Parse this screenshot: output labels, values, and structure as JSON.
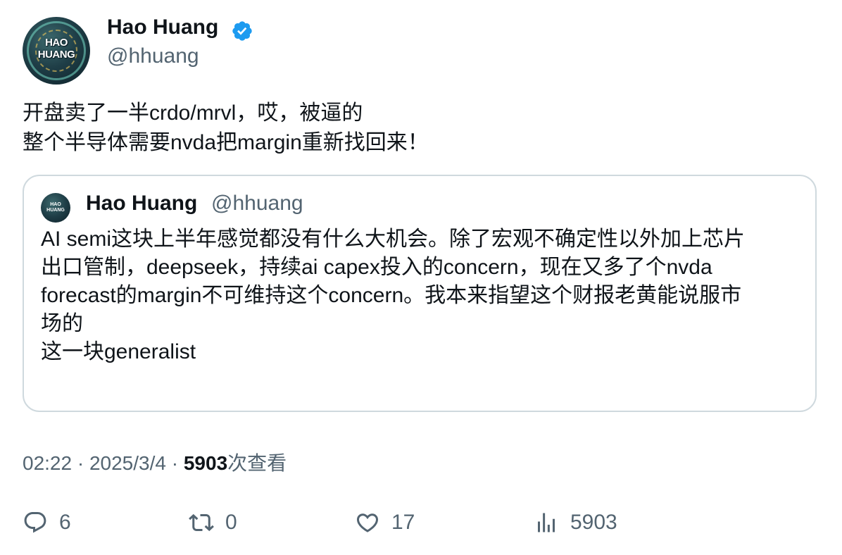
{
  "author": {
    "name": "Hao Huang",
    "handle": "@hhuang",
    "avatar_text_line1": "HAO",
    "avatar_text_line2": "HUANG",
    "verified_icon": "verified-badge-icon"
  },
  "tweet": {
    "lines": [
      "开盘卖了一半crdo/mrvl，哎，被逼的",
      "整个半导体需要nvda把margin重新找回来！"
    ]
  },
  "quote": {
    "name": "Hao Huang",
    "handle": "@hhuang",
    "lines": [
      "AI semi这块上半年感觉都没有什么大机会。除了宏观不确定性以外加上芯片",
      "出口管制，deepseek，持续ai capex投入的concern，现在又多了个nvda",
      "forecast的margin不可维持这个concern。我本来指望这个财报老黄能说服市",
      "场的",
      "这一块generalist"
    ]
  },
  "meta": {
    "time": "02:22",
    "sep1": " · ",
    "date": "2025/3/4",
    "sep2": " · ",
    "views_count": "5903",
    "views_label": "次查看"
  },
  "actions": {
    "replies": "6",
    "retweets": "0",
    "likes": "17",
    "views": "5903"
  },
  "colors": {
    "text_primary": "#0f1419",
    "text_secondary": "#536471",
    "verified_blue": "#1d9bf0",
    "border": "#cfd9de"
  }
}
